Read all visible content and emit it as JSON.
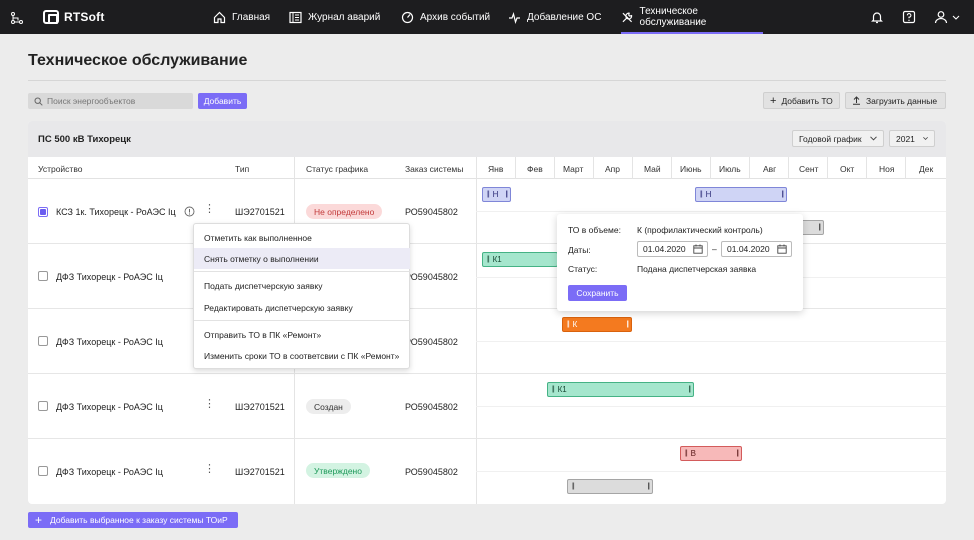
{
  "nav": {
    "logo": "RTSoft",
    "items": [
      {
        "label": "Главная",
        "icon": "home-icon"
      },
      {
        "label": "Журнал аварий",
        "icon": "journal-icon"
      },
      {
        "label": "Архив событий",
        "icon": "gauge-icon"
      },
      {
        "label": "Добавление ОС",
        "icon": "pulse-icon"
      },
      {
        "label": "Техническое обслуживание",
        "icon": "wrench-icon",
        "active": true
      }
    ],
    "right_icons": [
      "bell-icon",
      "help-icon",
      "user-icon"
    ]
  },
  "page": {
    "title": "Техническое обслуживание",
    "search_placeholder": "Поиск энергообъектов",
    "add_label": "Добавить",
    "add_to_label": "Добавить ТО",
    "upload_label": "Загрузить данные"
  },
  "panel": {
    "title": "ПС 500 кВ Тихорецк",
    "view_select": "Годовой график",
    "year_select": "2021",
    "columns": [
      "Устройство",
      "Тип",
      "Статус графика",
      "Заказ системы"
    ],
    "months": [
      "Янв",
      "Фев",
      "Март",
      "Апр",
      "Май",
      "Июнь",
      "Июль",
      "Авг",
      "Сент",
      "Окт",
      "Ноя",
      "Дек"
    ],
    "rows": [
      {
        "checked": true,
        "device": "КСЗ 1к. Тихорецк - РоАЭС Iц",
        "type": "ШЭ2701521",
        "status": "Не определено",
        "status_kind": "danger",
        "order": "РО59045802"
      },
      {
        "checked": false,
        "device": "ДФЗ Тихорецк - РоАЭС Iц",
        "type": "",
        "status": "",
        "status_kind": "",
        "order": "РО59045802"
      },
      {
        "checked": false,
        "device": "ДФЗ Тихорецк - РоАЭС Iц",
        "type": "",
        "status": "",
        "status_kind": "",
        "order": "РО59045802"
      },
      {
        "checked": false,
        "device": "ДФЗ Тихорецк - РоАЭС Iц",
        "type": "ШЭ2701521",
        "status": "Создан",
        "status_kind": "neutral",
        "order": "РО59045802"
      },
      {
        "checked": false,
        "device": "ДФЗ Тихорецк - РоАЭС Iц",
        "type": "ШЭ2701521",
        "status": "Утверждено",
        "status_kind": "success",
        "order": "РО59045802"
      }
    ]
  },
  "bars": [
    {
      "label": "Н",
      "kind": "blue"
    },
    {
      "label": "Н",
      "kind": "blue"
    },
    {
      "label": "",
      "kind": "gray"
    },
    {
      "label": "К1",
      "kind": "green"
    },
    {
      "label": "К",
      "kind": "orange"
    },
    {
      "label": "К1",
      "kind": "green"
    },
    {
      "label": "В",
      "kind": "red"
    },
    {
      "label": "",
      "kind": "gray"
    }
  ],
  "context_menu": {
    "items": [
      "Отметить как выполненное",
      "Снять отметку о выполнении",
      "Подать диспетчерскую заявку",
      "Редактировать диспетчерскую заявку",
      "Отправить ТО в ПК «Ремонт»",
      "Изменить сроки ТО в соответсвии с ПК «Ремонт»"
    ]
  },
  "popover": {
    "volume_label": "ТО в объеме:",
    "volume_value": "К (профилактический контроль)",
    "dates_label": "Даты:",
    "date_from": "01.04.2020",
    "date_sep": "–",
    "date_to": "01.04.2020",
    "status_label": "Статус:",
    "status_value": "Подана диспетчерская заявка",
    "save_label": "Сохранить"
  },
  "bottom_button": "Добавить выбранное к заказу системы ТОиР",
  "colors": {
    "accent": "#7b6cf6",
    "topbar": "#1d1d1f",
    "blue_bar": "#cfd4f5",
    "green_bar": "#a5e6cd",
    "orange_bar": "#f47a1f",
    "red_bar": "#f7b9b9",
    "gray_bar": "#dcdcdc"
  }
}
